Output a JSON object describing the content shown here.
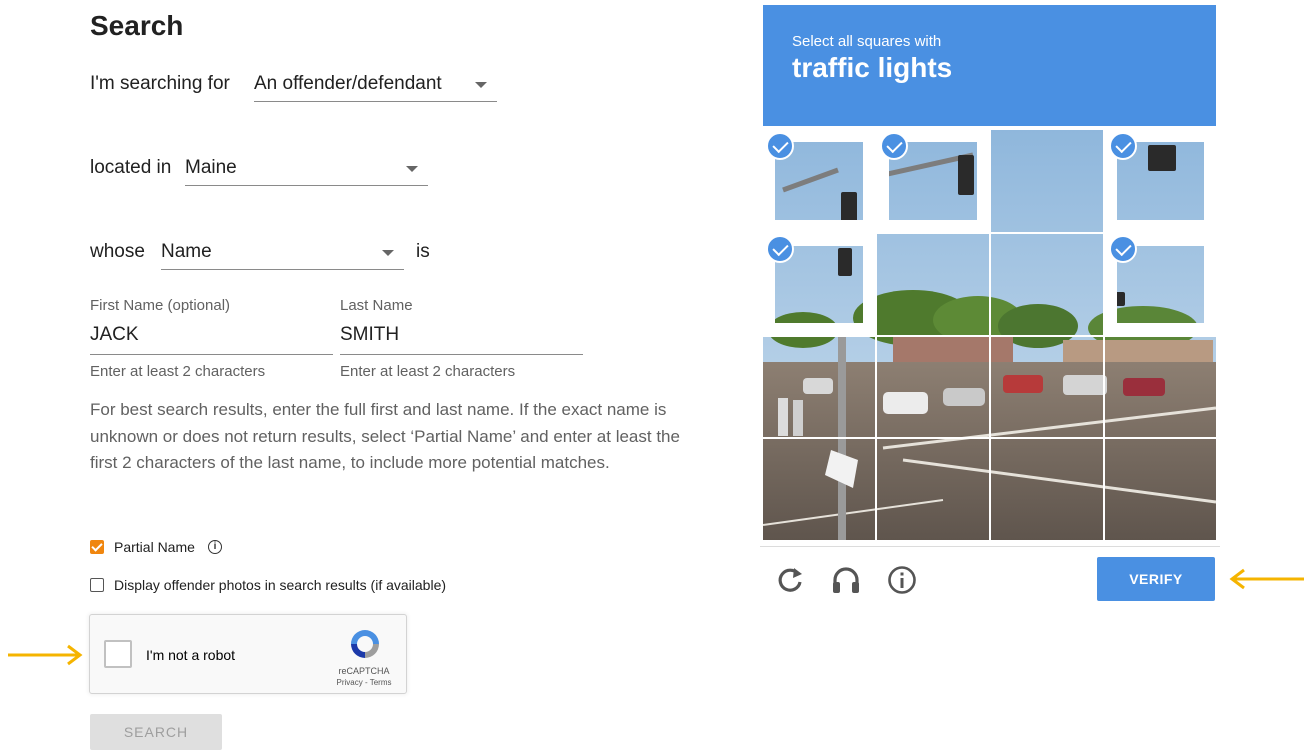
{
  "form": {
    "title": "Search",
    "searching_for_label": "I'm searching for",
    "searching_for_value": "An offender/defendant",
    "located_in_label": "located in",
    "located_in_value": "Maine",
    "whose_label": "whose",
    "whose_value": "Name",
    "is_label": "is",
    "first_name": {
      "label": "First Name (optional)",
      "value": "JACK",
      "helper": "Enter at least 2 characters"
    },
    "last_name": {
      "label": "Last Name",
      "value": "SMITH",
      "helper": "Enter at least 2 characters"
    },
    "info_text": "For best search results, enter the full first and last name. If the exact name is unknown or does not return results, select ‘Partial Name’ and enter at least the first 2 characters of the last name, to include more potential matches.",
    "partial_name": {
      "label": "Partial Name",
      "checked": true
    },
    "display_photos": {
      "label": "Display offender photos in search results (if available)",
      "checked": false
    },
    "search_button": "SEARCH"
  },
  "recaptcha": {
    "label": "I'm not a robot",
    "brand": "reCAPTCHA",
    "terms": "Privacy - Terms"
  },
  "challenge": {
    "instruction": "Select all squares with",
    "target": "traffic lights",
    "selected_tiles": [
      0,
      1,
      3,
      4,
      7
    ],
    "verify_button": "VERIFY",
    "controls": [
      "reload-icon",
      "audio-headphones-icon",
      "info-icon"
    ]
  },
  "colors": {
    "accent_blue": "#4a90e2",
    "checkbox_orange": "#f0860f",
    "annotation_arrow": "#f5b400"
  }
}
